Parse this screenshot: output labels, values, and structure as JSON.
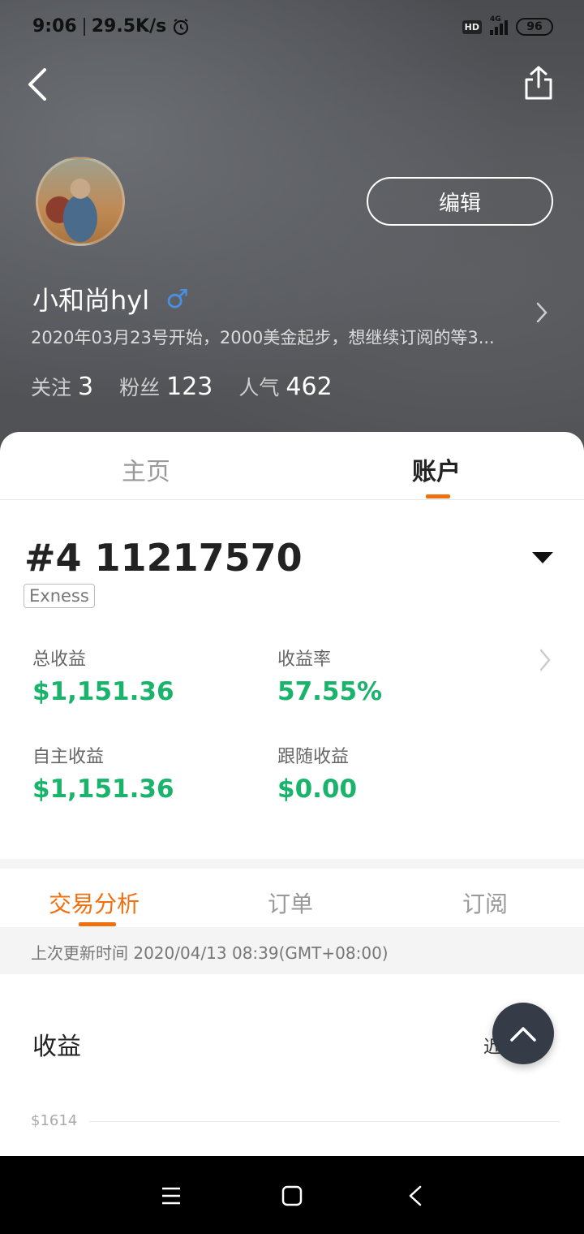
{
  "status_bar": {
    "time": "9:06",
    "network_speed": "29.5K/s",
    "hd": "HD",
    "network_type": "4G",
    "battery": "96"
  },
  "profile": {
    "edit_label": "编辑",
    "name": "小和尚hyl",
    "gender_icon": "♂",
    "bio": "2020年03月23号开始，2000美金起步，想继续订阅的等3...",
    "stats": [
      {
        "label": "关注",
        "value": "3"
      },
      {
        "label": "粉丝",
        "value": "123"
      },
      {
        "label": "人气",
        "value": "462"
      }
    ]
  },
  "top_tabs": [
    "主页",
    "账户"
  ],
  "account": {
    "number": "#4 11217570",
    "broker": "Exness",
    "metrics": [
      {
        "label": "总收益",
        "value": "$1,151.36"
      },
      {
        "label": "收益率",
        "value": "57.55%"
      },
      {
        "label": "自主收益",
        "value": "$1,151.36"
      },
      {
        "label": "跟随收益",
        "value": "$0.00"
      }
    ],
    "value_color": "#19b36b"
  },
  "sub_tabs": [
    "交易分析",
    "订单",
    "订阅"
  ],
  "update_text": "上次更新时间 2020/04/13 08:39(GMT+08:00)",
  "earnings": {
    "title": "收益",
    "period": "近一年",
    "axis_label": "$1614"
  },
  "accent_color": "#f07010"
}
